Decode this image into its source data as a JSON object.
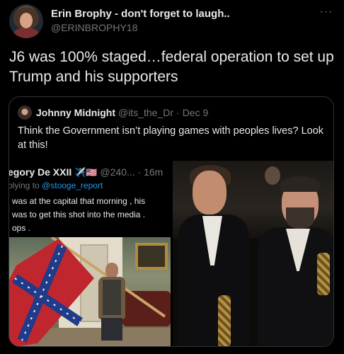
{
  "author": {
    "display_name": "Erin Brophy - don't forget to laugh..",
    "handle": "@ERINBROPHY18",
    "more_icon": "more-horizontal-icon"
  },
  "tweet": {
    "text": "J6 was 100% staged…federal operation to set up Trump and his supporters"
  },
  "quoted": {
    "display_name": "Johnny Midnight",
    "handle": "@its_the_Dr",
    "separator": "·",
    "date": "Dec 9",
    "text": "Think the Government isn’t playing games with peoples lives? Look at this!",
    "inner": {
      "name": "egory De XXII",
      "flags": "✈️🇺🇸",
      "handle_time": "@240... · 16m",
      "reply_prefix": "plying to",
      "reply_mention": "@stooge_report",
      "text": " was at the capital that morning , his\n was to get  this shot into the media .\nops ."
    }
  },
  "colors": {
    "background": "#000000",
    "text": "#e7e9ea",
    "muted": "#71767b",
    "link": "#1d9bf0",
    "border": "#2f3336"
  }
}
